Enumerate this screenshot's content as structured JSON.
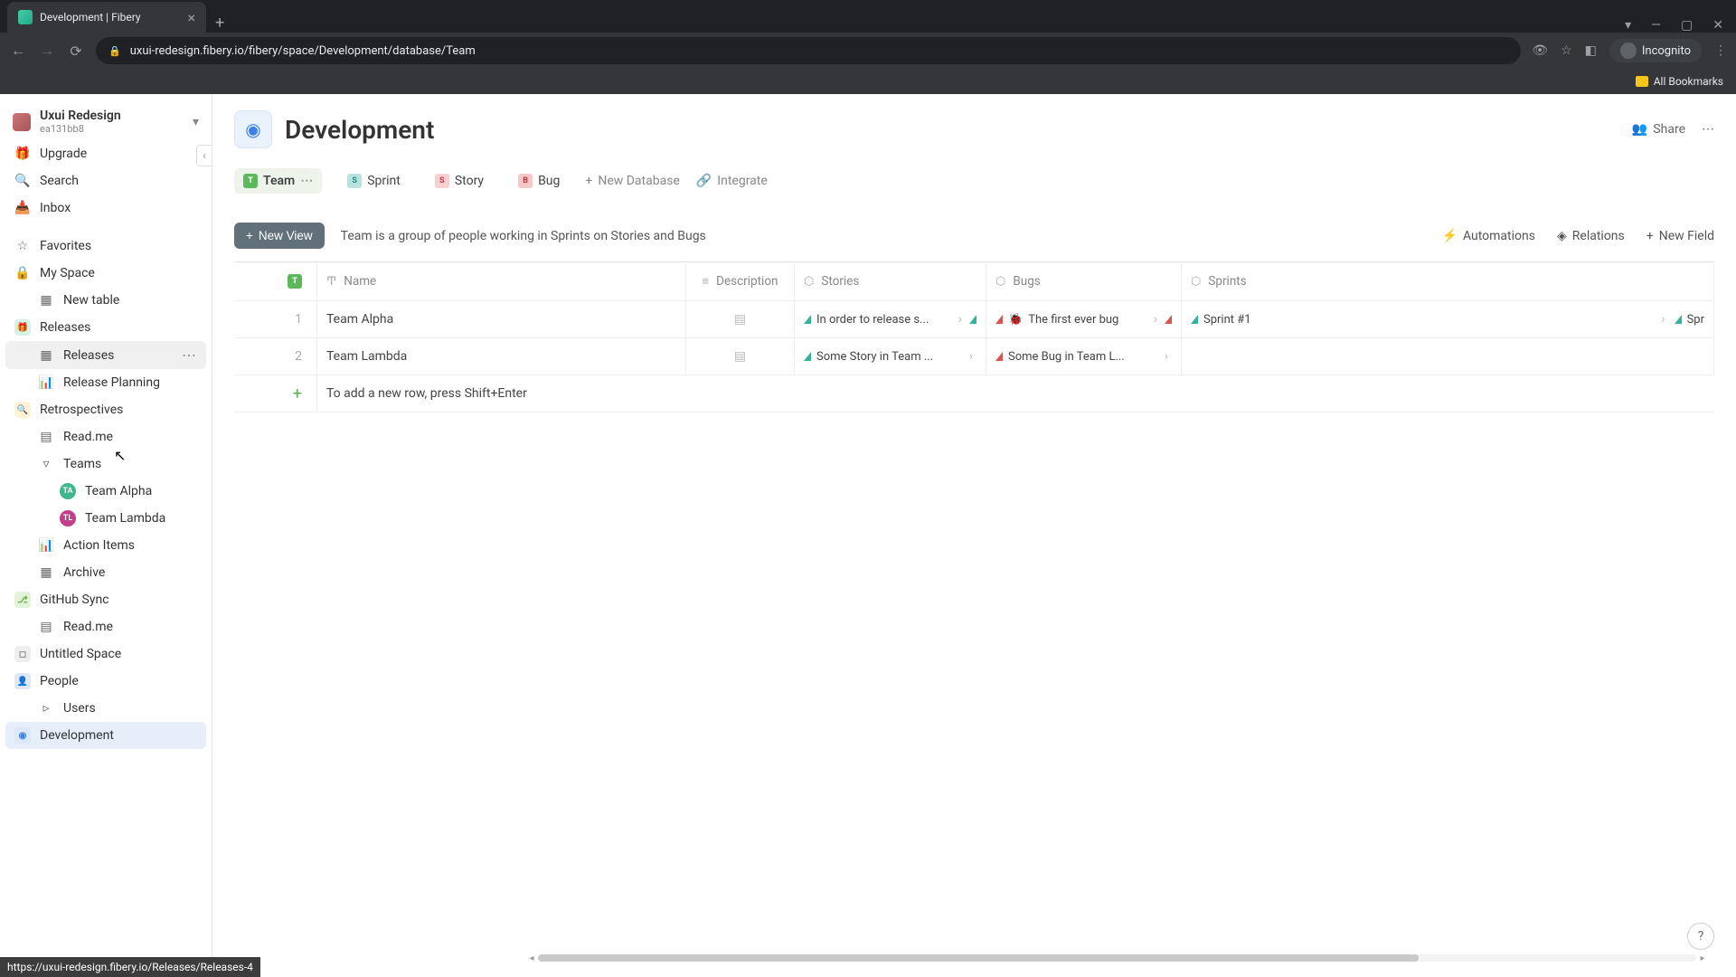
{
  "browser": {
    "tab_title": "Development | Fibery",
    "url": "uxui-redesign.fibery.io/fibery/space/Development/database/Team",
    "incognito_label": "Incognito",
    "bookmarks_label": "All Bookmarks",
    "status_url": "https://uxui-redesign.fibery.io/Releases/Releases-4"
  },
  "workspace": {
    "name": "Uxui Redesign",
    "sub": "ea131bb8"
  },
  "sidebar": {
    "upgrade": "Upgrade",
    "search": "Search",
    "inbox": "Inbox",
    "favorites": "Favorites",
    "myspace": "My Space",
    "newtable": "New table",
    "releases_space": "Releases",
    "releases_view": "Releases",
    "release_planning": "Release Planning",
    "retro": "Retrospectives",
    "readme1": "Read.me",
    "teams_folder": "Teams",
    "team_alpha": "Team Alpha",
    "team_lambda": "Team Lambda",
    "action_items": "Action Items",
    "archive": "Archive",
    "github": "GitHub Sync",
    "readme2": "Read.me",
    "untitled": "Untitled Space",
    "people": "People",
    "users": "Users",
    "development": "Development"
  },
  "page": {
    "title": "Development",
    "share": "Share"
  },
  "db_tabs": {
    "team": "Team",
    "sprint": "Sprint",
    "story": "Story",
    "bug": "Bug",
    "new_db": "New Database",
    "integrate": "Integrate"
  },
  "view": {
    "new_view": "New View",
    "description": "Team is a group of people working in Sprints on Stories and Bugs",
    "automations": "Automations",
    "relations": "Relations",
    "new_field": "New Field"
  },
  "columns": {
    "name": "Name",
    "description": "Description",
    "stories": "Stories",
    "bugs": "Bugs",
    "sprints": "Sprints"
  },
  "rows": [
    {
      "idx": "1",
      "name": "Team Alpha",
      "story": "In order to release s...",
      "bug": "The first ever bug",
      "sprint": "Sprint #1",
      "sprint2": "Spr"
    },
    {
      "idx": "2",
      "name": "Team Lambda",
      "story": "Some Story in Team ...",
      "bug": "Some Bug in Team L..."
    }
  ],
  "new_row_hint": "To add a new row, press Shift+Enter"
}
